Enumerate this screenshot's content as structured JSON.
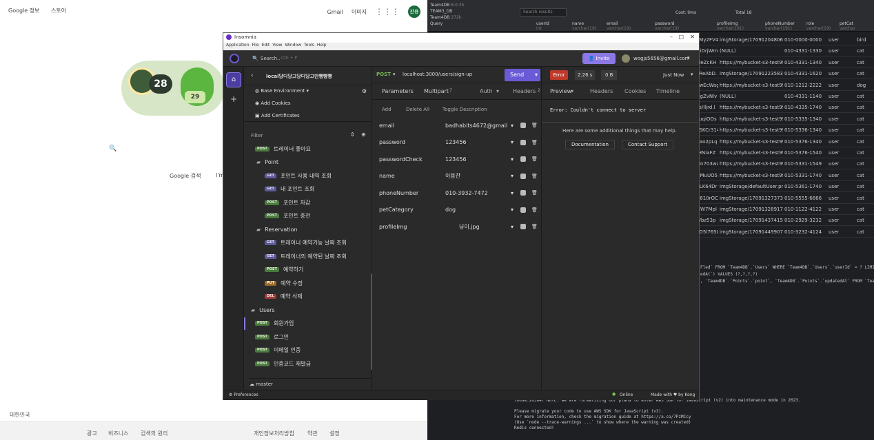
{
  "google": {
    "top_left": [
      "Google 정보",
      "스토어"
    ],
    "top_right": [
      "Gmail",
      "이미지"
    ],
    "avatar": "찬용",
    "doodle": {
      "number1": "28",
      "number2": "29"
    },
    "search_buttons": [
      "Google 검색",
      "I'm"
    ],
    "country": "대한민국",
    "footer_left": [
      "광고",
      "비즈니스",
      "검색의 원리"
    ],
    "footer_right": [
      "개인정보처리방침",
      "약관",
      "설정"
    ]
  },
  "db": {
    "tree": [
      "Team4DB",
      "TEAM3_DB",
      "Team4DB",
      "Query"
    ],
    "tree_meta": [
      "8.0.35",
      "",
      "272k",
      ""
    ],
    "toolbar": {
      "search": "Search results",
      "cost": "Cost: 9ms",
      "total": "Total 18"
    },
    "columns": [
      {
        "name": "userId",
        "type": "int"
      },
      {
        "name": "name",
        "type": "varchar(19)"
      },
      {
        "name": "email",
        "type": "varchar(19)"
      },
      {
        "name": "password",
        "type": "varchar(19)"
      },
      {
        "name": "profileImg",
        "type": "varchar(191)"
      },
      {
        "name": "phoneNumber",
        "type": "varchar(191)"
      },
      {
        "name": "role",
        "type": "varchar(19)"
      },
      {
        "name": "petCat",
        "type": "varchar"
      }
    ],
    "rows": [
      [
        "eMy2FV4",
        "imgStorage/170912048060",
        "010-0000-0000",
        "user",
        "bird"
      ],
      [
        "OiDrjWm",
        "(NULL)",
        "010-4331-1330",
        "user",
        "cat"
      ],
      [
        "6leZcKH",
        "https://mybucket-s3-test99",
        "010-4331-1340",
        "user",
        "cat"
      ],
      [
        "7ReAbD.",
        "imgStorage/170912235832",
        "010-4331-1620",
        "user",
        "cat"
      ],
      [
        "SwEcWag",
        "https://mybucket-s3-test99",
        "010-1212-2222",
        "user",
        "dog"
      ],
      [
        "OgZvNlv",
        "(NULL)",
        "010-4331-1140",
        "user",
        "cat"
      ],
      [
        "os/lljrd.l",
        "https://mybucket-s3-test99",
        "010-4335-1740",
        "user",
        "cat"
      ],
      [
        "PuqiOOs",
        "https://mybucket-s3-test99",
        "010-5335-1340",
        "user",
        "cat"
      ],
      [
        "3SKCr314",
        "https://mybucket-s3-test99",
        "010-5336-1340",
        "user",
        "cat"
      ],
      [
        "Bao2pLq",
        "https://mybucket-s3-test99",
        "010-5376-1340",
        "user",
        "cat"
      ],
      [
        "tHNiaFZ",
        "https://mybucket-s3-test99",
        "010-5376-1540",
        "user",
        "cat"
      ],
      [
        "Mn703wa",
        "https://mybucket-s3-test99",
        "010-5331-1549",
        "user",
        "cat"
      ],
      [
        "OMuUO5",
        "https://mybucket-s3-test99",
        "010-5331-1740",
        "user",
        "cat"
      ],
      [
        "VLK64Dr",
        "imgStorage/defaultUser.pn",
        "010-5361-1740",
        "user",
        "cat"
      ],
      [
        "N610rOC",
        "imgStorage/170913273737",
        "010-5555-6666",
        "user",
        "cat"
      ],
      [
        "xlW7Mpl",
        "imgStorage/170913289171",
        "010-1122-4122",
        "user",
        "cat"
      ],
      [
        "Wbz53p",
        "imgStorage/170914374156",
        "010-2929-3232",
        "user",
        "cat"
      ],
      [
        "gD5l765L",
        "imgStorage/170914499074",
        "010-3232-4124",
        "user",
        "cat"
      ]
    ],
    "sql_lines": [
      "Fled` FROM `Team4DB`.`Users` WHERE `Team4DB`.`Users`.`userId` = ? LIMIT",
      "",
      "edAt`) VALUES (?,?,?,?)",
      ", `Team4DB`.`Points`.`point`, `Team4DB`.`Points`.`updatedAt` FROM `Team"
    ],
    "terminal_label": "bash",
    "console_lines": [
      "(node:26384) NOTE: We are formalizing our plans to enter AWS SDK for JavaScript (v2) into maintenance mode in 2023.",
      "",
      "Please migrate your code to use AWS SDK for JavaScript (v3).",
      "For more information, check the migration guide at https://a.co/7PzMCcy",
      "(Use `node --trace-warnings ...` to show where the warning was created)",
      "Redis connected!"
    ]
  },
  "insomnia": {
    "title": "Insomnia",
    "menu": [
      "Application",
      "File",
      "Edit",
      "View",
      "Window",
      "Tools",
      "Help"
    ],
    "search": {
      "placeholder": "Search..",
      "shortcut": "Ctrl + P"
    },
    "invite": "Invite",
    "user_email": "wogjs5656@gmail.com",
    "collection": "local당디당고당디당고만빵빵빵",
    "method": "POST",
    "url": "localhost:3000/users/sign-up",
    "send": "Send",
    "status": "Error",
    "time": "2.26 s",
    "size": "0 B",
    "history": "Just Now",
    "base_env": "Base Environment",
    "add_cookies": "Add Cookies",
    "add_certificates": "Add Certificates",
    "filter_placeholder": "Filter",
    "sidebar": [
      {
        "method": "POST",
        "label": "트레이너 좋아요"
      },
      {
        "folder": "Point"
      },
      {
        "method": "GET",
        "label": "포인트 사용 내역 조회"
      },
      {
        "method": "GET",
        "label": "내 포인트 조회"
      },
      {
        "method": "POST",
        "label": "포인트 차감"
      },
      {
        "method": "POST",
        "label": "포인트 충전"
      },
      {
        "folder": "Reservation"
      },
      {
        "method": "GET",
        "label": "트레이너 예약가능 날짜 조회"
      },
      {
        "method": "GET",
        "label": "트레이너의 예약된 날짜 조회"
      },
      {
        "method": "POST",
        "label": "예약하기"
      },
      {
        "method": "PUT",
        "label": "예약 수정"
      },
      {
        "method": "DEL",
        "label": "예약 삭제"
      },
      {
        "folder": "Users"
      },
      {
        "method": "POST",
        "label": "회원가입"
      },
      {
        "method": "POST",
        "label": "로그인"
      },
      {
        "method": "POST",
        "label": "이메일 인증"
      },
      {
        "method": "POST",
        "label": "인증코드 재발급"
      }
    ],
    "branch": "master",
    "req_tabs": [
      "Parameters",
      "Multipart",
      "Auth",
      "Headers"
    ],
    "req_tab_counts": {
      "multipart": "7",
      "headers": "2"
    },
    "actions": [
      "Add",
      "Delete All",
      "Toggle Description"
    ],
    "fields": [
      {
        "name": "email",
        "value": "badhabits4672@gmail"
      },
      {
        "name": "password",
        "value": "123456"
      },
      {
        "name": "passwordCheck",
        "value": "123456"
      },
      {
        "name": "name",
        "value": "이용찬"
      },
      {
        "name": "phoneNumber",
        "value": "010-3932-7472"
      },
      {
        "name": "petCategory",
        "value": "dog"
      },
      {
        "name": "profileImg",
        "value": "냥이.jpg"
      }
    ],
    "resp_tabs": [
      "Preview",
      "Headers",
      "Cookies",
      "Timeline"
    ],
    "error_text": "Error: Couldn't connect to server",
    "help_text": "Here are some additional things that may help.",
    "documentation": "Documentation",
    "contact": "Contact Support",
    "preferences": "Preferences",
    "online": "Online",
    "made_with": "Made with ♥ by Kong"
  },
  "colors": {
    "post": "#4a7a3d",
    "get": "#5d5a9b",
    "send": "#6b5ad6",
    "error": "#c0392b"
  }
}
